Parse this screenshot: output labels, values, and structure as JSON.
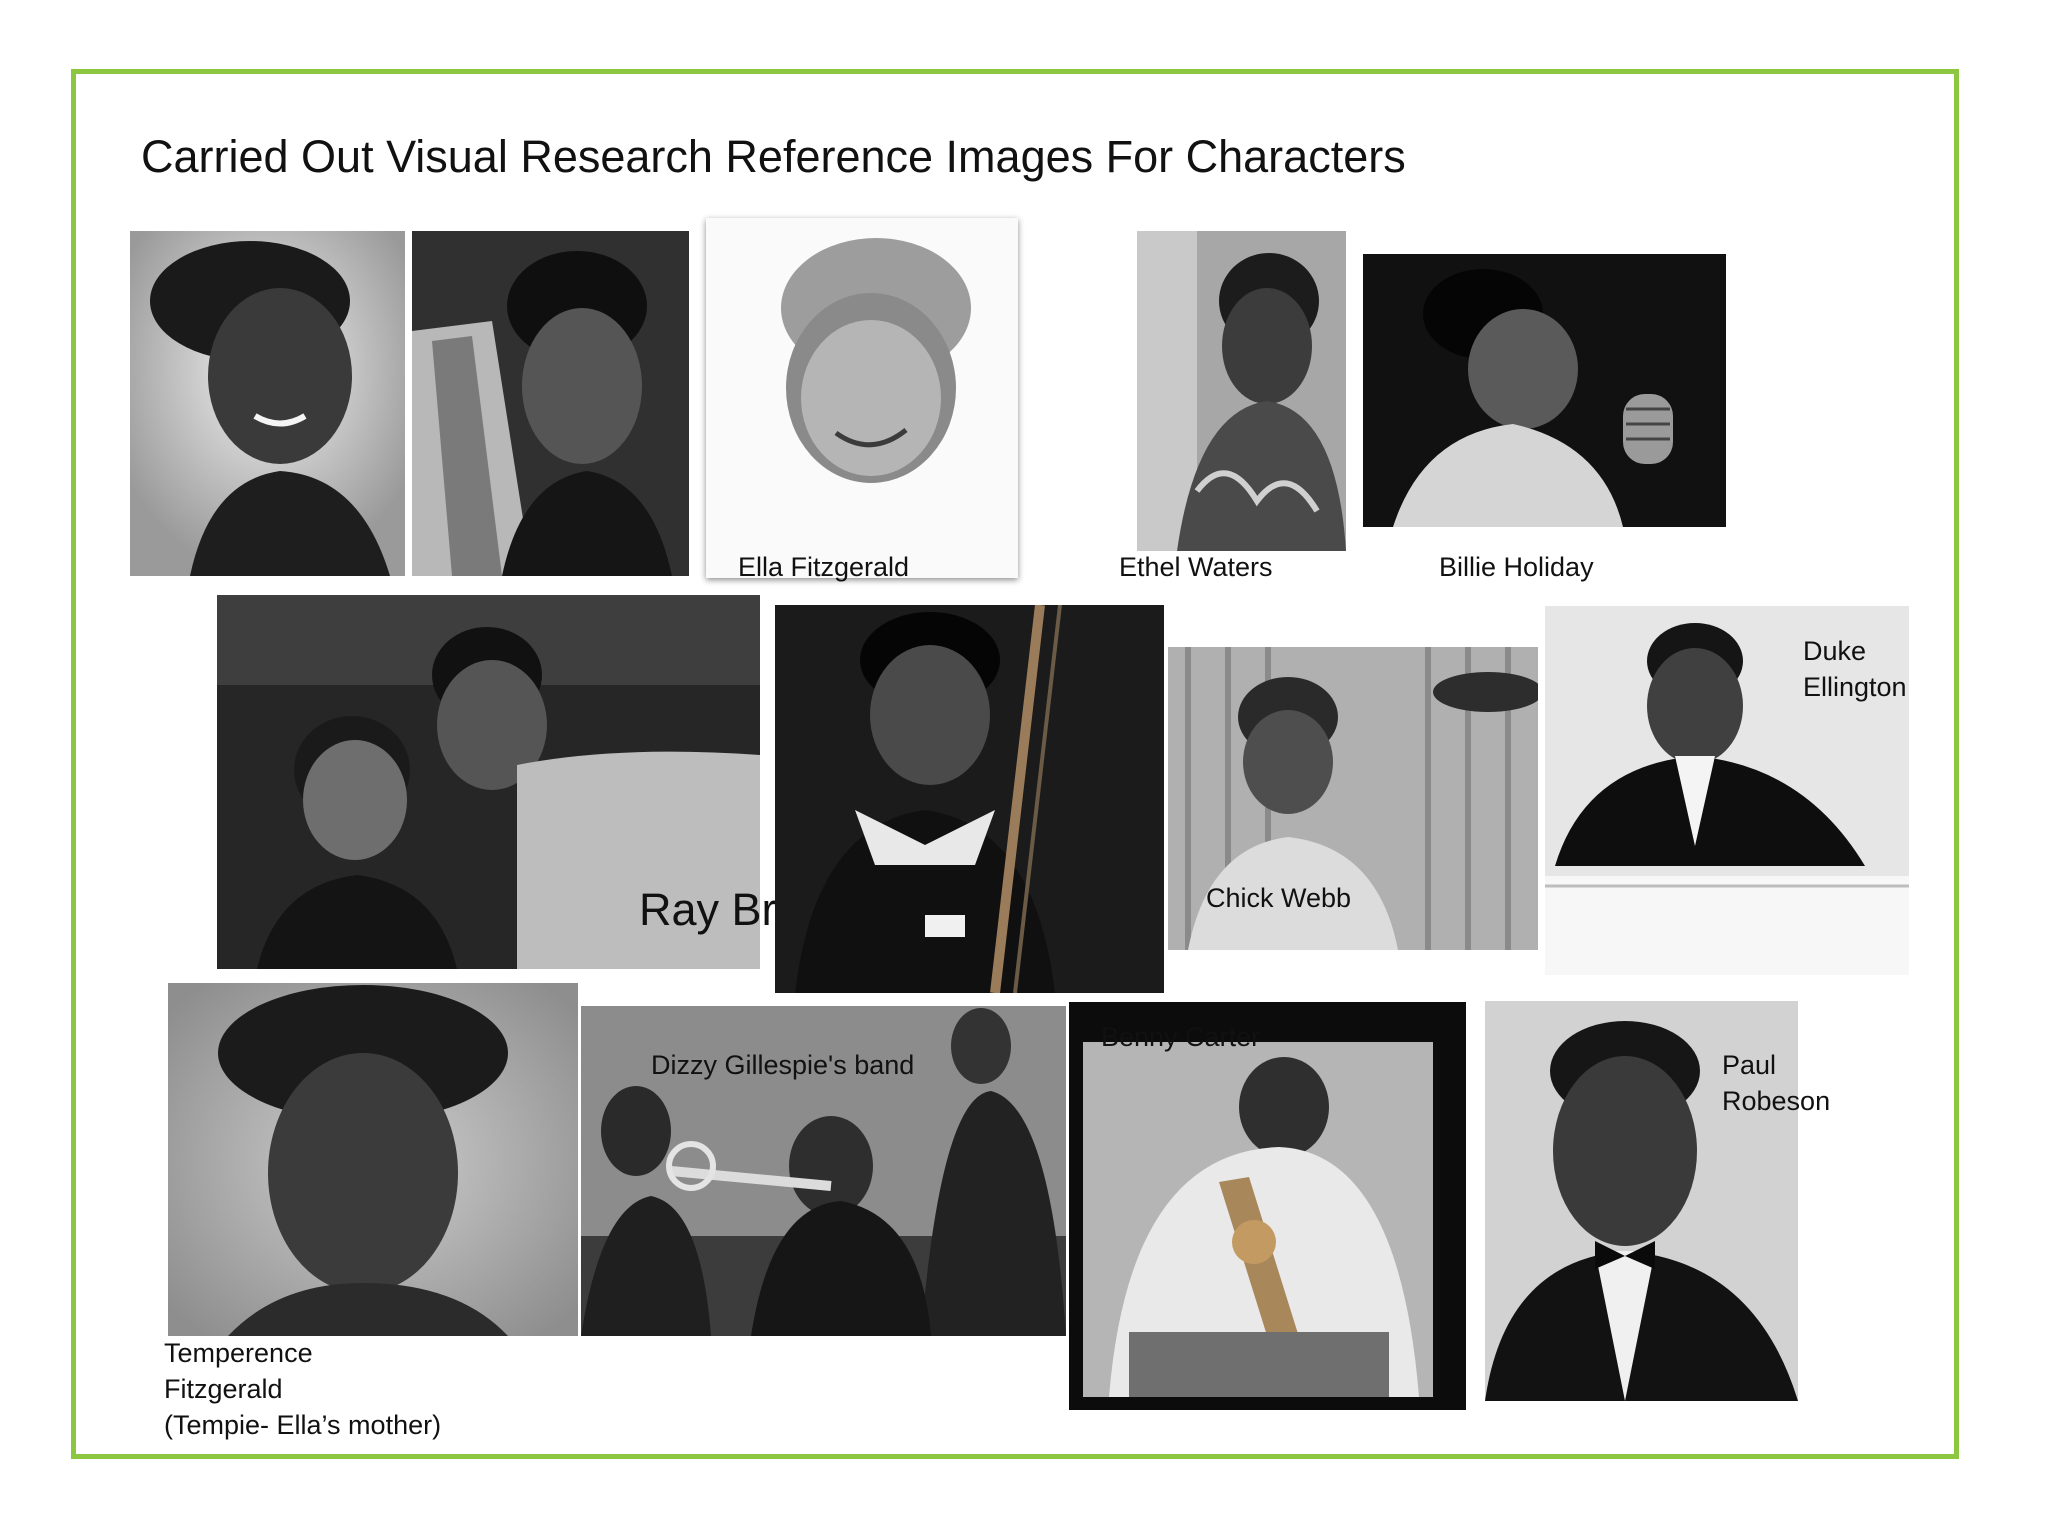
{
  "slide": {
    "title": "Carried Out Visual Research Reference Images For Characters",
    "border_color": "#8dc63f"
  },
  "photos": [
    {
      "name": "ella-fitzgerald-portrait-1",
      "caption": null
    },
    {
      "name": "ella-fitzgerald-portrait-2",
      "caption": null
    },
    {
      "name": "ella-fitzgerald-sketch",
      "caption": "Ella Fitzgerald"
    },
    {
      "name": "ethel-waters-photo",
      "caption": "Ethel Waters"
    },
    {
      "name": "billie-holiday-photo",
      "caption": "Billie Holiday"
    },
    {
      "name": "ray-brown-with-ella-photo",
      "caption": "Ray Brown"
    },
    {
      "name": "bassist-photo",
      "caption": null
    },
    {
      "name": "chick-webb-photo",
      "caption": "Chick Webb"
    },
    {
      "name": "duke-ellington-photo",
      "caption_lines": [
        "Duke",
        "Ellington"
      ]
    },
    {
      "name": "temperence-fitzgerald-photo",
      "caption_lines": [
        "Temperence",
        "Fitzgerald",
        "(Tempie- Ella’s mother)"
      ]
    },
    {
      "name": "dizzy-gillespie-band-photo",
      "caption": "Dizzy Gillespie's band"
    },
    {
      "name": "benny-carter-photo",
      "caption": "Benny Carter"
    },
    {
      "name": "paul-robeson-photo",
      "caption_lines": [
        "Paul",
        "Robeson"
      ]
    }
  ]
}
